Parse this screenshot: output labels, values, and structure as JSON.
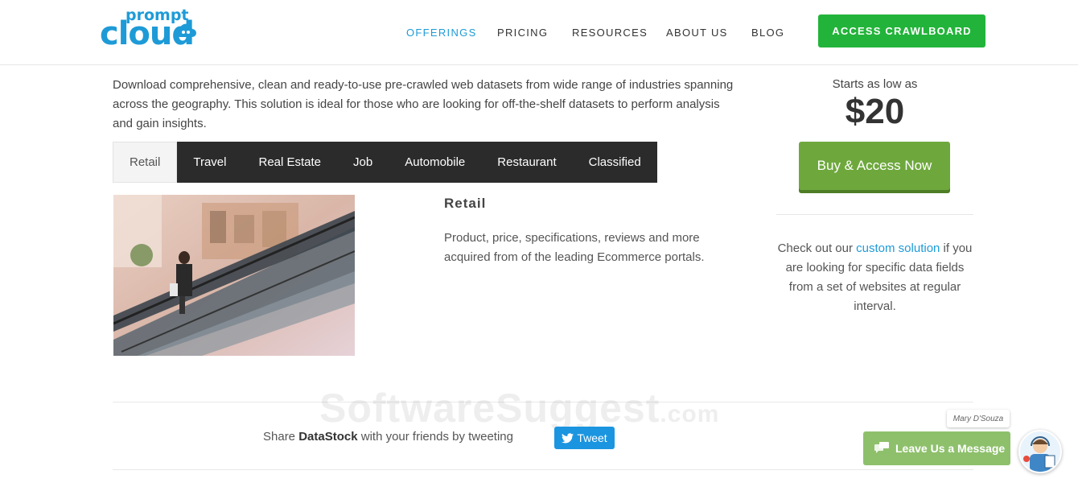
{
  "header": {
    "logo_top": "prompt",
    "logo_bottom": "cloud",
    "nav": [
      {
        "label": "OFFERINGS"
      },
      {
        "label": "PRICING"
      },
      {
        "label": "RESOURCES"
      },
      {
        "label": "ABOUT US"
      },
      {
        "label": "BLOG"
      }
    ],
    "cta_label": "ACCESS CRAWLBOARD"
  },
  "colors": {
    "accent_blue": "#1e9bd7",
    "cta_green": "#22b43a",
    "buy_green": "#6ea83d",
    "tab_dark": "#2b2b2b",
    "tweet_blue": "#1b95e0",
    "chat_green": "#8ec06c"
  },
  "intro": {
    "text": "Download comprehensive, clean and ready-to-use pre-crawled web datasets from wide range of industries spanning across the geography. This solution is ideal for those who are looking for off-the-shelf datasets to perform analysis and gain insights."
  },
  "tabs": [
    {
      "label": "Retail"
    },
    {
      "label": "Travel"
    },
    {
      "label": "Real Estate"
    },
    {
      "label": "Job"
    },
    {
      "label": "Automobile"
    },
    {
      "label": "Restaurant"
    },
    {
      "label": "Classified"
    }
  ],
  "detail": {
    "title": "Retail",
    "description": "Product, price, specifications, reviews and more acquired from of the leading Ecommerce portals."
  },
  "sidebar": {
    "starts_label": "Starts as low as",
    "price": "$20",
    "buy_label": "Buy & Access Now",
    "text_before": "Check out our ",
    "link_text": "custom solution",
    "text_after": " if you are looking for specific data fields from a set of websites at regular interval."
  },
  "share": {
    "prefix": "Share ",
    "product": "DataStock",
    "suffix": " with your friends by tweeting",
    "tweet_label": "Tweet"
  },
  "watermark": {
    "main": "SoftwareSuggest",
    "suffix": ".com"
  },
  "chat": {
    "agent_name": "Mary D'Souza",
    "button_label": "Leave Us a Message",
    "icon": "chat-bubbles-icon"
  }
}
